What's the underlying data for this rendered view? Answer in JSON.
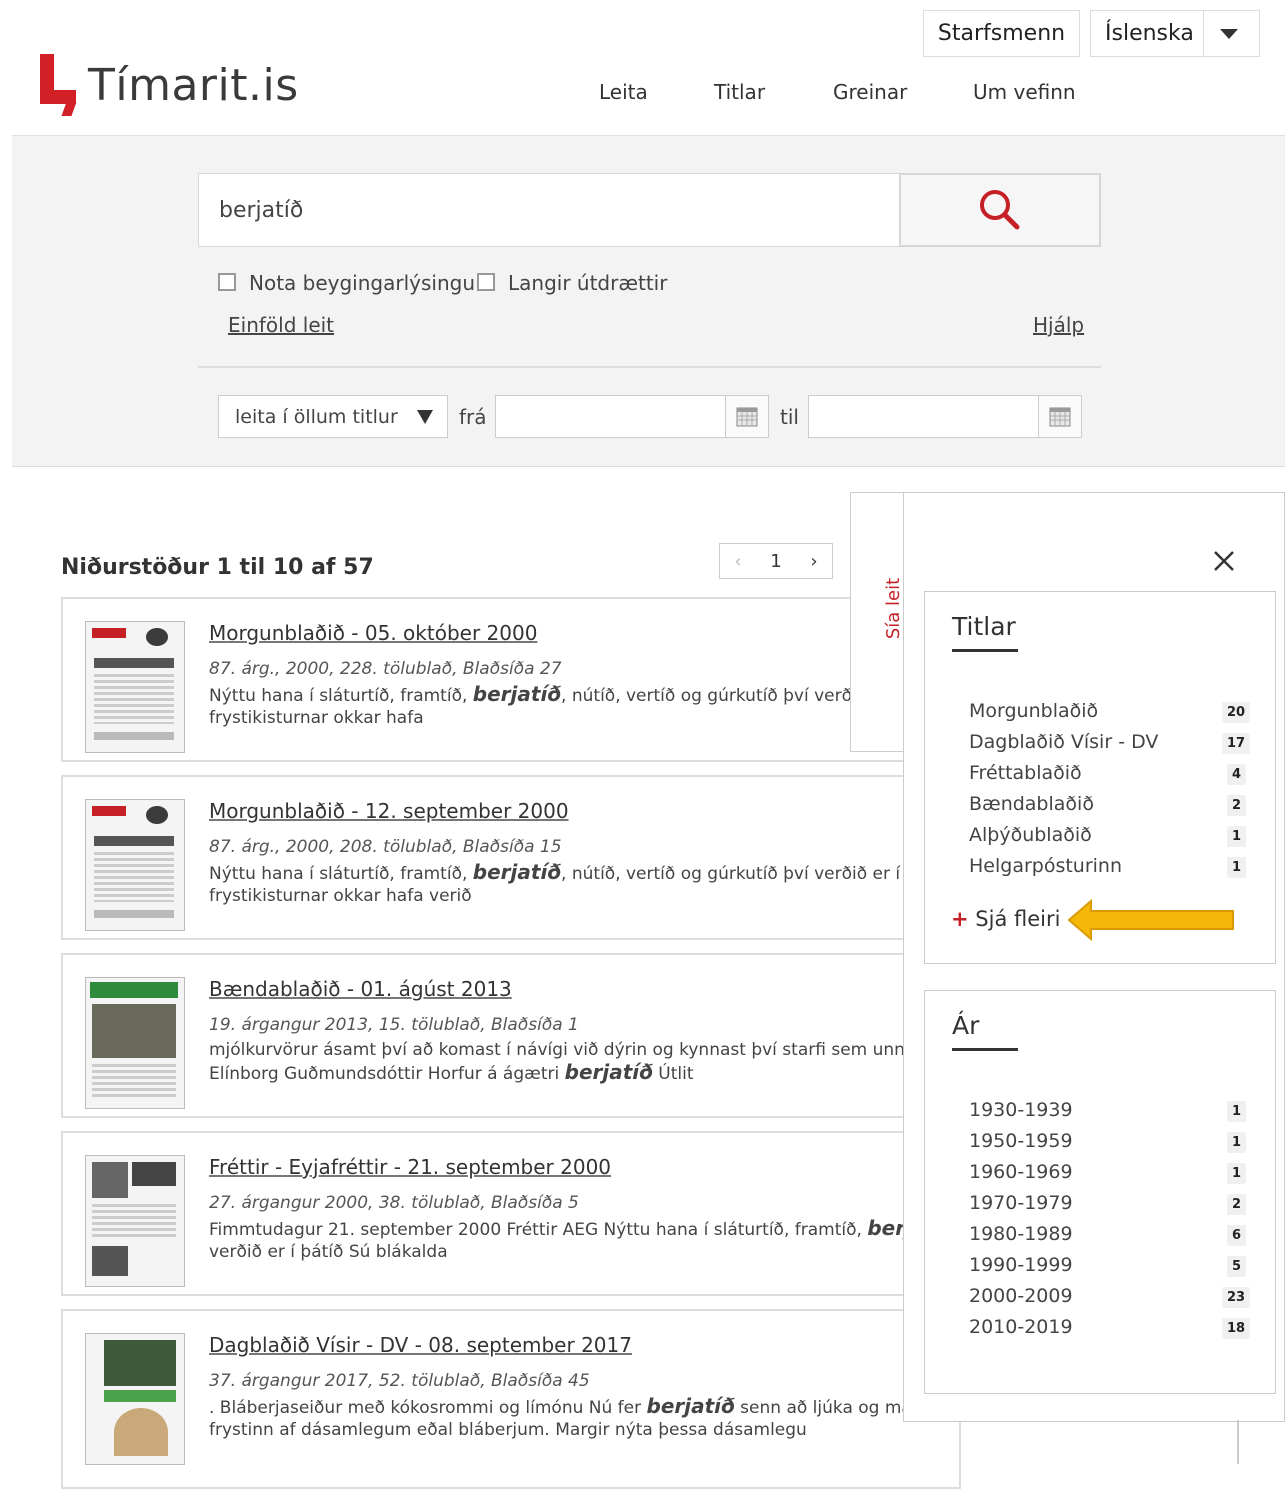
{
  "header": {
    "logo_text": "Tímarit.is",
    "staff_button": "Starfsmenn",
    "language": "Íslenska",
    "nav": [
      "Leita",
      "Titlar",
      "Greinar",
      "Um vefinn"
    ]
  },
  "search": {
    "query": "berjatíð",
    "option_inflection": "Nota beygingarlýsingu",
    "option_long_excerpts": "Langir útdrættir",
    "simple_search_link": "Einföld leit",
    "help_link": "Hjálp",
    "title_select": "leita í öllum titlur",
    "from_label": "frá",
    "to_label": "til"
  },
  "results": {
    "heading": "Niðurstöður 1 til 10 af 57",
    "page": "1",
    "items": [
      {
        "title": "Morgunblaðið - 05. október 2000",
        "meta": "87. árg., 2000, 228. tölublað, Blaðsíða 27",
        "snippet_pre": "Nýttu hana í sláturtíð, framtíð, ",
        "highlight": "berjatíð",
        "snippet_post": ", nútíð, vertíð og gúrkutíð því verðið e",
        "snippet_line2": "frystikisturnar okkar hafa"
      },
      {
        "title": "Morgunblaðið - 12. september 2000",
        "meta": "87. árg., 2000, 208. tölublað, Blaðsíða 15",
        "snippet_pre": "Nýttu hana í sláturtíð, framtíð, ",
        "highlight": "berjatíð",
        "snippet_post": ", nútíð, vertíð og gúrkutíð því verðið er í þát",
        "snippet_line2": "frystikisturnar okkar hafa verið"
      },
      {
        "title": "Bændablaðið - 01. ágúst 2013",
        "meta": "19. árgangur 2013, 15. tölublað, Blaðsíða 1",
        "snippet_pre": "mjólkurvörur ásamt því að komast í návígi við dýrin og kynnast því starfi sem unnið e",
        "highlight": "",
        "snippet_post": "",
        "snippet_line2_pre": "Elínborg Guðmundsdóttir Horfur á ágætri ",
        "snippet_line2_highlight": "berjatíð",
        "snippet_line2_post": " Útlit"
      },
      {
        "title": "Fréttir - Eyjafréttir - 21. september 2000",
        "meta": "27. árgangur 2000, 38. tölublað, Blaðsíða 5",
        "snippet_pre": "Fimmtudagur 21. september 2000 Fréttir AEG Nýttu hana í sláturtíð, framtíð, ",
        "highlight": "berja",
        "snippet_post": "",
        "snippet_line2": "verðið er í þátíð Sú blákalda"
      },
      {
        "title": "Dagblaðið Vísir - DV - 08. september 2017",
        "meta": "37. árgangur 2017, 52. tölublað, Blaðsíða 45",
        "snippet_pre": ". Bláberjaseiður með kókosrommi og límónu Nú fer ",
        "highlight": "berjatíð",
        "snippet_post": " senn að ljúka og mar",
        "snippet_line2": "frystinn af dásamlegum eðal bláberjum. Margir nýta þessa dásamlegu"
      }
    ]
  },
  "sidebar": {
    "tab_label": "Sía leit",
    "titles_heading": "Titlar",
    "titles": [
      {
        "name": "Morgunblaðið",
        "count": "20"
      },
      {
        "name": "Dagblaðið Vísir - DV",
        "count": "17"
      },
      {
        "name": "Fréttablaðið",
        "count": "4"
      },
      {
        "name": "Bændablaðið",
        "count": "2"
      },
      {
        "name": "Alþýðublaðið",
        "count": "1"
      },
      {
        "name": "Helgarpósturinn",
        "count": "1"
      }
    ],
    "see_more": "Sjá fleiri",
    "years_heading": "Ár",
    "years": [
      {
        "name": "1930-1939",
        "count": "1"
      },
      {
        "name": "1950-1959",
        "count": "1"
      },
      {
        "name": "1960-1969",
        "count": "1"
      },
      {
        "name": "1970-1979",
        "count": "2"
      },
      {
        "name": "1980-1989",
        "count": "6"
      },
      {
        "name": "1990-1999",
        "count": "5"
      },
      {
        "name": "2000-2009",
        "count": "23"
      },
      {
        "name": "2010-2019",
        "count": "18"
      }
    ]
  },
  "colors": {
    "brand_red": "#d32027",
    "arrow_yellow": "#f5b70a"
  }
}
